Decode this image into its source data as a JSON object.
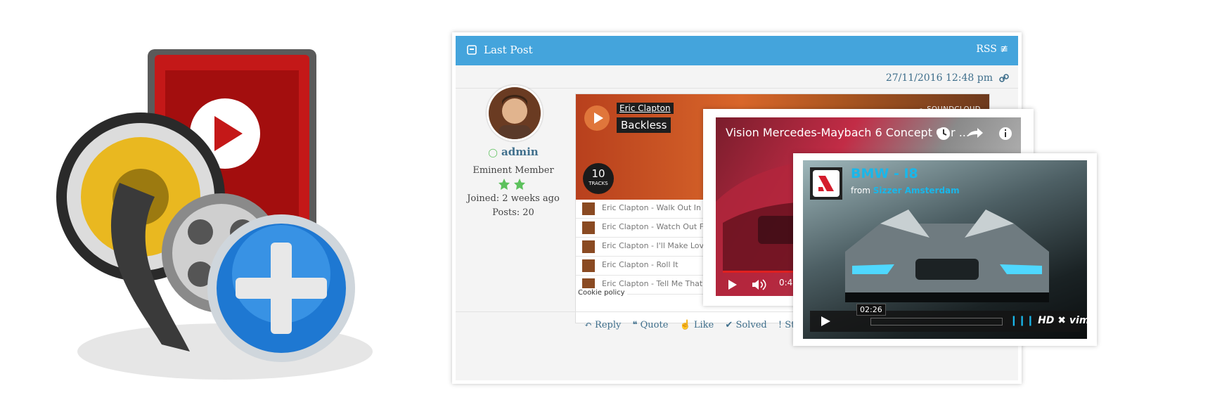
{
  "forum": {
    "header_title": "Last Post",
    "rss_label": "RSS",
    "post_date": "27/11/2016 12:48 pm",
    "user": {
      "name": "admin",
      "rank": "Eminent Member",
      "stars": 2,
      "joined": "Joined: 2 weeks  ago",
      "posts": "Posts: 20"
    },
    "actions": [
      "Reply",
      "Quote",
      "Like",
      "Solved",
      "Sticky"
    ]
  },
  "soundcloud": {
    "artist": "Eric Clapton",
    "title": "Backless",
    "logo": "SOUNDCLOUD",
    "track_count": "10",
    "track_count_label": "TRACKS",
    "tracks": [
      "Eric Clapton - Walk Out In",
      "Eric Clapton - Watch Out F",
      "Eric Clapton - I'll Make Lov",
      "Eric Clapton - Roll It",
      "Eric Clapton - Tell Me That"
    ],
    "cookie_policy": "Cookie policy"
  },
  "youtube": {
    "title": "Vision Mercedes-Maybach 6 Concept Car ...",
    "time": "0:49",
    "progress_fraction": 0.25
  },
  "vimeo": {
    "title": "BMW - I8",
    "from_prefix": "from",
    "from_channel": "Sizzer Amsterdam",
    "time_bubble": "02:26",
    "hd_label": "HD",
    "brand": "vimeo"
  },
  "colors": {
    "header_blue": "#44a4dc",
    "link_blue": "#3f6f8c",
    "vimeo_accent": "#19b7ea",
    "youtube_red": "#e02020",
    "star_green": "#5cc15c"
  }
}
